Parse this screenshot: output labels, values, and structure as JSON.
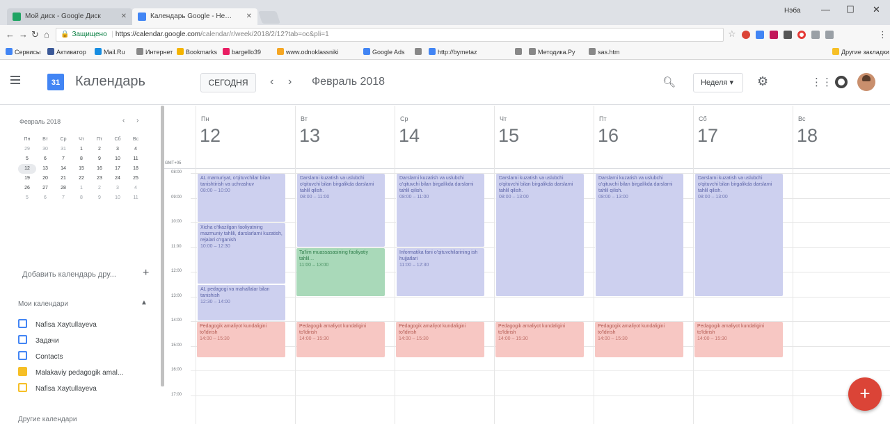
{
  "browser": {
    "tabs": [
      {
        "title": "Мой диск - Google Диск",
        "active": false,
        "color": "#1fa463"
      },
      {
        "title": "Календарь Google - Не…",
        "active": true,
        "color": "#4285f4"
      }
    ],
    "window_user": "Нэба",
    "url_secure_label": "Защищено",
    "url_host": "https://calendar.google.com",
    "url_path": "/calendar/r/week/2018/2/12?tab=oc&pli=1",
    "bookmarks": [
      {
        "label": "Сервисы",
        "color": "#4285f4"
      },
      {
        "label": "Активатор",
        "color": "#3b5998"
      },
      {
        "label": "Mail.Ru",
        "color": "#168de2"
      },
      {
        "label": "Интернет",
        "color": "#888888"
      },
      {
        "label": "Bookmarks",
        "color": "#f4b400"
      },
      {
        "label": "bargello39",
        "color": "#e91e63"
      },
      {
        "label": "www.odnoklassniki",
        "color": "#f5a623"
      },
      {
        "label": "Google Ads",
        "color": "#4285f4"
      },
      {
        "label": "",
        "color": "#888888"
      },
      {
        "label": "http://bymetaz",
        "color": "#4285f4"
      },
      {
        "label": "",
        "color": "#888888"
      },
      {
        "label": "Методика.Ру",
        "color": "#888888"
      },
      {
        "label": "sas.htm",
        "color": "#888888"
      }
    ],
    "other_bookmarks": "Другие закладки"
  },
  "header": {
    "app_title": "Календарь",
    "logo_number": "31",
    "today_label": "СЕГОДНЯ",
    "month_title": "Февраль 2018",
    "view_label": "Неделя"
  },
  "sidebar": {
    "mini_month": "Февраль 2018",
    "mini_weekdays": [
      "Пн",
      "Вт",
      "Ср",
      "Чт",
      "Пт",
      "Сб",
      "Вс"
    ],
    "mini_weeks": [
      [
        "29",
        "30",
        "31",
        "1",
        "2",
        "3",
        "4"
      ],
      [
        "5",
        "6",
        "7",
        "8",
        "9",
        "10",
        "11"
      ],
      [
        "12",
        "13",
        "14",
        "15",
        "16",
        "17",
        "18"
      ],
      [
        "19",
        "20",
        "21",
        "22",
        "23",
        "24",
        "25"
      ],
      [
        "26",
        "27",
        "28",
        "1",
        "2",
        "3",
        "4"
      ],
      [
        "5",
        "6",
        "7",
        "8",
        "9",
        "10",
        "11"
      ]
    ],
    "add_calendar": "Добавить календарь дру...",
    "my_calendars_title": "Мои календари",
    "my_calendars": [
      {
        "label": "Nafisa Xaytullayeva",
        "color": "#4285f4",
        "checked": false
      },
      {
        "label": "Задачи",
        "color": "#4285f4",
        "checked": false
      },
      {
        "label": "Contacts",
        "color": "#4285f4",
        "checked": false
      },
      {
        "label": "Malakaviy pedagogik amal...",
        "color": "#f6bf26",
        "checked": true
      },
      {
        "label": "Nafisa Xaytullayeva",
        "color": "#f6bf26",
        "checked": false
      }
    ],
    "other_calendars_title": "Другие календари"
  },
  "week": {
    "timezone": "GMT+05",
    "days": [
      {
        "dow": "Пн",
        "num": "12"
      },
      {
        "dow": "Вт",
        "num": "13"
      },
      {
        "dow": "Ср",
        "num": "14"
      },
      {
        "dow": "Чт",
        "num": "15"
      },
      {
        "dow": "Пт",
        "num": "16"
      },
      {
        "dow": "Сб",
        "num": "17"
      },
      {
        "dow": "Вс",
        "num": "18"
      }
    ],
    "hours": [
      "08:00",
      "09:00",
      "10:00",
      "11:00",
      "12:00",
      "13:00",
      "14:00",
      "15:00",
      "16:00",
      "17:00"
    ],
    "events": [
      {
        "day": 0,
        "start": 8.0,
        "end": 10.0,
        "color": "blue",
        "title": "AL mamuriyat, o'qituvchilar bilan tanishtirish va uchrashuv",
        "time": "08:00 – 10:00"
      },
      {
        "day": 0,
        "start": 10.0,
        "end": 12.5,
        "color": "blue",
        "title": "Xicha o'tkazilgan faoliyatning mazmuniy tahlili, darslarlarni kuzatish, rejalari o'rganish",
        "time": "10:00 – 12:30"
      },
      {
        "day": 0,
        "start": 12.5,
        "end": 14.0,
        "color": "blue",
        "title": "AL pedagogi va mahallalar bilan tanishish",
        "time": "12:30 – 14:00"
      },
      {
        "day": 0,
        "start": 14.0,
        "end": 15.5,
        "color": "red",
        "title": "Pedagogik amaliyot kundaligini to'ldirish",
        "time": "14:00 – 15:30"
      },
      {
        "day": 1,
        "start": 8.0,
        "end": 11.0,
        "color": "blue",
        "title": "Darslarni kuzatish va uslubchi o'qituvchi bilan birgalikda darslarni tahlil qilish.",
        "time": "08:00 – 11:00"
      },
      {
        "day": 1,
        "start": 11.0,
        "end": 13.0,
        "color": "green",
        "title": "Ta'lim muassasasining faoliyatiy tahlil…",
        "time": "11:00 – 13:00"
      },
      {
        "day": 1,
        "start": 14.0,
        "end": 15.5,
        "color": "red",
        "title": "Pedagogik amaliyot kundaligini to'ldirish",
        "time": "14:00 – 15:30"
      },
      {
        "day": 2,
        "start": 8.0,
        "end": 11.0,
        "color": "blue",
        "title": "Darslarni kuzatish va uslubchi o'qituvchi bilan birgalikda darslarni tahlil qilish.",
        "time": "08:00 – 11:00"
      },
      {
        "day": 2,
        "start": 11.0,
        "end": 13.0,
        "color": "blue",
        "title": "Informatika fani o'qituvchilarining ish hujjatlari",
        "time": "11:00 – 12:30"
      },
      {
        "day": 2,
        "start": 14.0,
        "end": 15.5,
        "color": "red",
        "title": "Pedagogik amaliyot kundaligini to'ldirish",
        "time": "14:00 – 15:30"
      },
      {
        "day": 3,
        "start": 8.0,
        "end": 13.0,
        "color": "blue",
        "title": "Darslarni kuzatish va uslubchi o'qituvchi bilan birgalikda darslarni tahlil qilish.",
        "time": "08:00 – 13:00"
      },
      {
        "day": 3,
        "start": 14.0,
        "end": 15.5,
        "color": "red",
        "title": "Pedagogik amaliyot kundaligini to'ldirish",
        "time": "14:00 – 15:30"
      },
      {
        "day": 4,
        "start": 8.0,
        "end": 13.0,
        "color": "blue",
        "title": "Darslarni kuzatish va uslubchi o'qituvchi bilan birgalikda darslarni tahlil qilish.",
        "time": "08:00 – 13:00"
      },
      {
        "day": 4,
        "start": 14.0,
        "end": 15.5,
        "color": "red",
        "title": "Pedagogik amaliyot kundaligini to'ldirish",
        "time": "14:00 – 15:30"
      },
      {
        "day": 5,
        "start": 8.0,
        "end": 13.0,
        "color": "blue",
        "title": "Darslarni kuzatish va uslubchi o'qituvchi bilan birgalikda darslarni tahlil qilish.",
        "time": "08:00 – 13:00"
      },
      {
        "day": 5,
        "start": 14.0,
        "end": 15.5,
        "color": "red",
        "title": "Pedagogik amaliyot kundaligini to'ldirish",
        "time": "14:00 – 15:30"
      }
    ]
  },
  "fab_label": "+"
}
